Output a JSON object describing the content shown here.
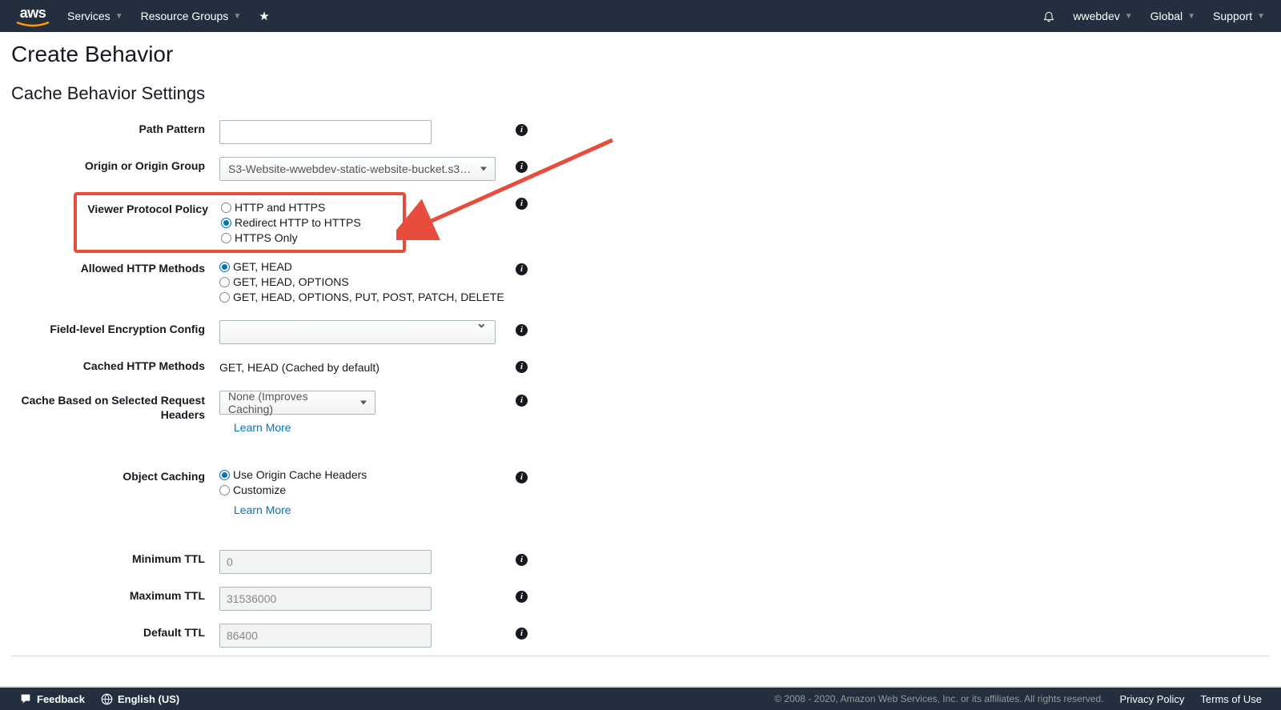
{
  "nav": {
    "services": "Services",
    "resource_groups": "Resource Groups",
    "pin": "★",
    "user": "wwebdev",
    "region": "Global",
    "support": "Support"
  },
  "page": {
    "title": "Create Behavior",
    "section_title": "Cache Behavior Settings"
  },
  "form": {
    "path_pattern": {
      "label": "Path Pattern",
      "value": ""
    },
    "origin": {
      "label": "Origin or Origin Group",
      "selected": "S3-Website-wwebdev-static-website-bucket.s3…"
    },
    "viewer_protocol": {
      "label": "Viewer Protocol Policy",
      "options": [
        "HTTP and HTTPS",
        "Redirect HTTP to HTTPS",
        "HTTPS Only"
      ],
      "selected_index": 1
    },
    "allowed_methods": {
      "label": "Allowed HTTP Methods",
      "options": [
        "GET, HEAD",
        "GET, HEAD, OPTIONS",
        "GET, HEAD, OPTIONS, PUT, POST, PATCH, DELETE"
      ],
      "selected_index": 0
    },
    "field_encryption": {
      "label": "Field-level Encryption Config",
      "selected": ""
    },
    "cached_methods": {
      "label": "Cached HTTP Methods",
      "value": "GET, HEAD (Cached by default)"
    },
    "cache_headers": {
      "label": "Cache Based on Selected Request Headers",
      "selected": "None (Improves Caching)",
      "learn_more": "Learn More"
    },
    "object_caching": {
      "label": "Object Caching",
      "options": [
        "Use Origin Cache Headers",
        "Customize"
      ],
      "selected_index": 0,
      "learn_more": "Learn More"
    },
    "min_ttl": {
      "label": "Minimum TTL",
      "value": "0"
    },
    "max_ttl": {
      "label": "Maximum TTL",
      "value": "31536000"
    },
    "default_ttl": {
      "label": "Default TTL",
      "value": "86400"
    }
  },
  "footer": {
    "feedback": "Feedback",
    "language": "English (US)",
    "copyright": "© 2008 - 2020, Amazon Web Services, Inc. or its affiliates. All rights reserved.",
    "privacy": "Privacy Policy",
    "terms": "Terms of Use"
  }
}
